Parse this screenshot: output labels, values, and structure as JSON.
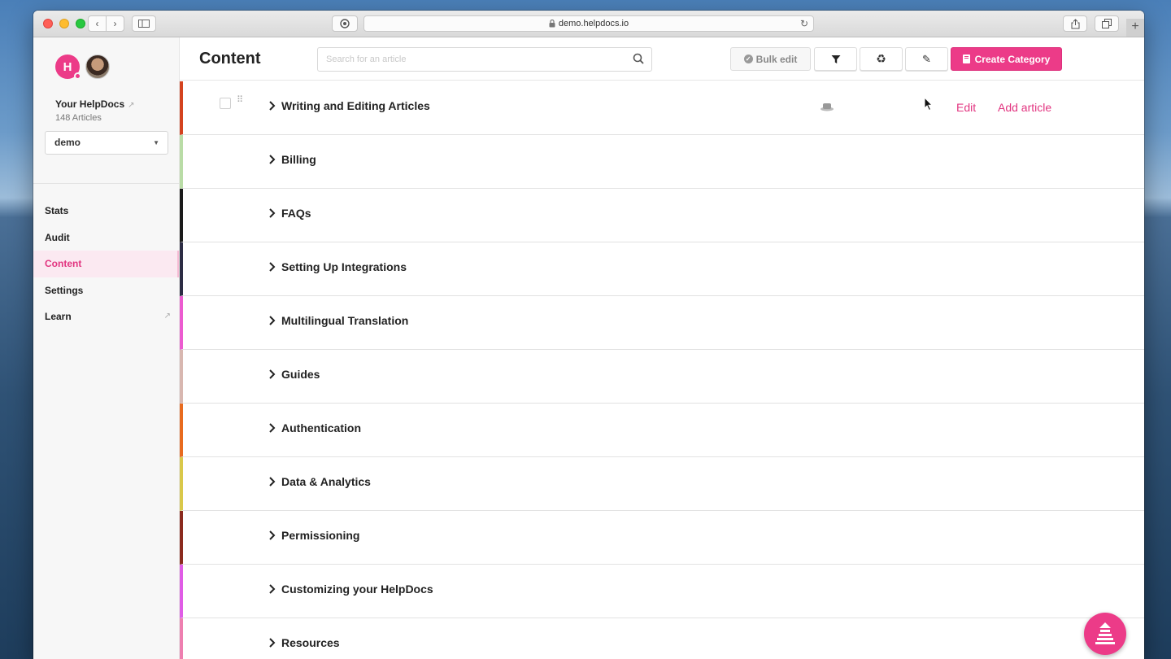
{
  "browser": {
    "url": "demo.helpdocs.io",
    "nav_back": "‹",
    "nav_forward": "›"
  },
  "sidebar": {
    "logo_letter": "H",
    "org_name": "Your HelpDocs",
    "article_count": "148 Articles",
    "site_select_value": "demo",
    "nav_items": [
      {
        "label": "Stats"
      },
      {
        "label": "Audit"
      },
      {
        "label": "Content"
      },
      {
        "label": "Settings"
      },
      {
        "label": "Learn"
      }
    ]
  },
  "header": {
    "title": "Content",
    "search_placeholder": "Search for an article",
    "bulk_edit_label": "Bulk edit",
    "create_category_label": "Create Category"
  },
  "categories": [
    {
      "title": "Writing and Editing Articles",
      "color": "#d4431f",
      "edit_label": "Edit",
      "add_label": "Add article"
    },
    {
      "title": "Billing",
      "color": "#b9dca6"
    },
    {
      "title": "FAQs",
      "color": "#1a1a1a"
    },
    {
      "title": "Setting Up Integrations",
      "color": "#2c2c44"
    },
    {
      "title": "Multilingual Translation",
      "color": "#ec5bd0"
    },
    {
      "title": "Guides",
      "color": "#d8b7b0"
    },
    {
      "title": "Authentication",
      "color": "#e86b1f"
    },
    {
      "title": "Data & Analytics",
      "color": "#d9c84a"
    },
    {
      "title": "Permissioning",
      "color": "#8b2a1e"
    },
    {
      "title": "Customizing your HelpDocs",
      "color": "#e05ce6"
    },
    {
      "title": "Resources",
      "color": "#ee7fb0"
    }
  ],
  "colors": {
    "accent": "#ec3b88"
  }
}
